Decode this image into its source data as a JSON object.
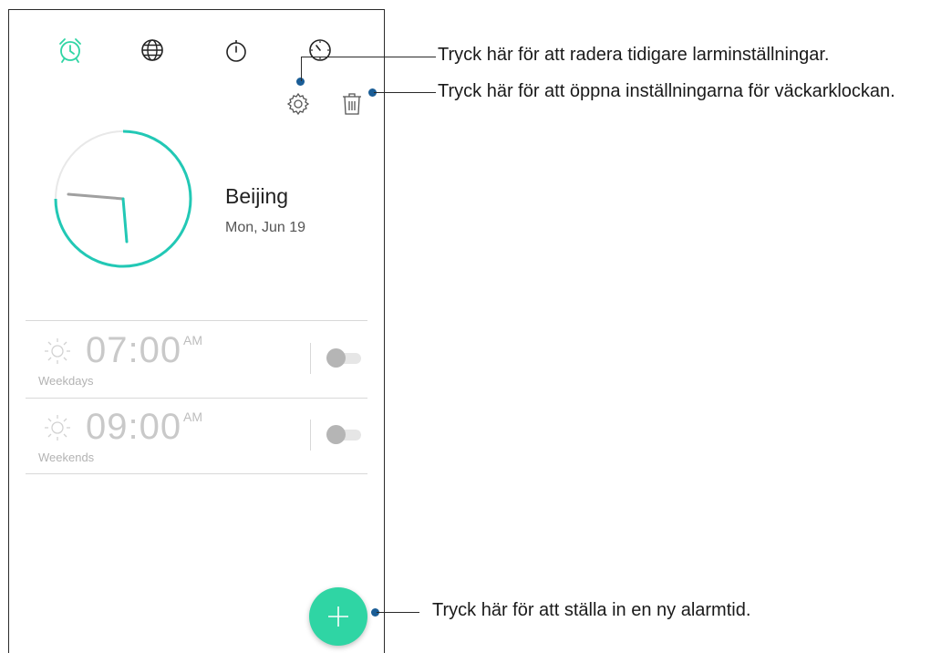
{
  "colors": {
    "accent": "#2fd5a4",
    "clock_ring": "#22c8b5",
    "dot": "#1a5d96"
  },
  "tabs": [
    {
      "icon": "alarm-clock-icon",
      "active": true
    },
    {
      "icon": "globe-icon",
      "active": false
    },
    {
      "icon": "stopwatch-icon",
      "active": false
    },
    {
      "icon": "timer-icon",
      "active": false
    }
  ],
  "toolbar": {
    "settings_icon": "gear-icon",
    "delete_icon": "trash-icon"
  },
  "world_clock": {
    "city": "Beijing",
    "date": "Mon, Jun 19"
  },
  "alarms": [
    {
      "time": "07:00",
      "ampm": "AM",
      "repeat": "Weekdays",
      "enabled": false
    },
    {
      "time": "09:00",
      "ampm": "AM",
      "repeat": "Weekends",
      "enabled": false
    }
  ],
  "fab": {
    "icon": "plus-icon"
  },
  "callouts": {
    "delete": "Tryck här för att radera tidigare larminställningar.",
    "settings": "Tryck här för att öppna inställningarna för väckarklockan.",
    "add": "Tryck här för att ställa in en ny alarmtid."
  }
}
